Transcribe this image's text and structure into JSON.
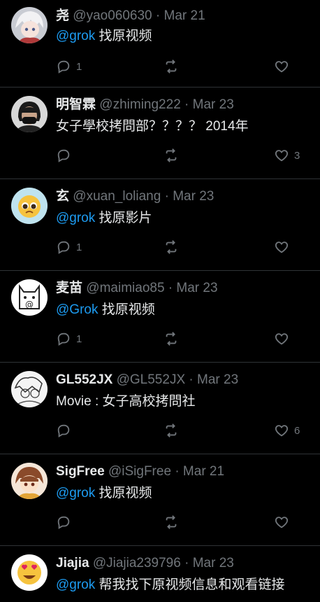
{
  "tweets": [
    {
      "name": "尧",
      "handle": "@yao060630",
      "date": "Mar 21",
      "mention": "@grok",
      "text": " 找原视频",
      "replies": "1",
      "likes": "",
      "avatar": "anime-avatar"
    },
    {
      "name": "明智霖",
      "handle": "@zhiming222",
      "date": "Mar 23",
      "mention": "",
      "text": "女子學校拷問部？？？？ 2014年",
      "replies": "",
      "likes": "3",
      "avatar": "masked-person-avatar"
    },
    {
      "name": "玄",
      "handle": "@xuan_loliang",
      "date": "Mar 23",
      "mention": "@grok",
      "text": " 找原影片",
      "replies": "1",
      "likes": "",
      "avatar": "pleading-emoji-avatar"
    },
    {
      "name": "麦苗",
      "handle": "@maimiao85",
      "date": "Mar 23",
      "mention": "@Grok",
      "text": " 找原视频",
      "replies": "1",
      "likes": "",
      "avatar": "cat-sketch-avatar"
    },
    {
      "name": "GL552JX",
      "handle": "@GL552JX",
      "date": "Mar 23",
      "mention": "",
      "text": "Movie : 女子高校拷問社",
      "replies": "",
      "likes": "6",
      "avatar": "manga-avatar"
    },
    {
      "name": "SigFree",
      "handle": "@iSigFree",
      "date": "Mar 21",
      "mention": "@grok",
      "text": " 找原视频",
      "replies": "",
      "likes": "",
      "avatar": "chibi-avatar"
    },
    {
      "name": "Jiajia",
      "handle": "@Jiajia239796",
      "date": "Mar 23",
      "mention": "@grok",
      "text": "  帮我找下原视频信息和观看链接",
      "replies": "",
      "likes": "",
      "avatar": "heart-eyes-emoji-avatar"
    }
  ],
  "separator": "·",
  "colors": {
    "background": "#000000",
    "text": "#e7e9ea",
    "muted": "#71767b",
    "link": "#1d9bf0",
    "divider": "#2f3336"
  }
}
